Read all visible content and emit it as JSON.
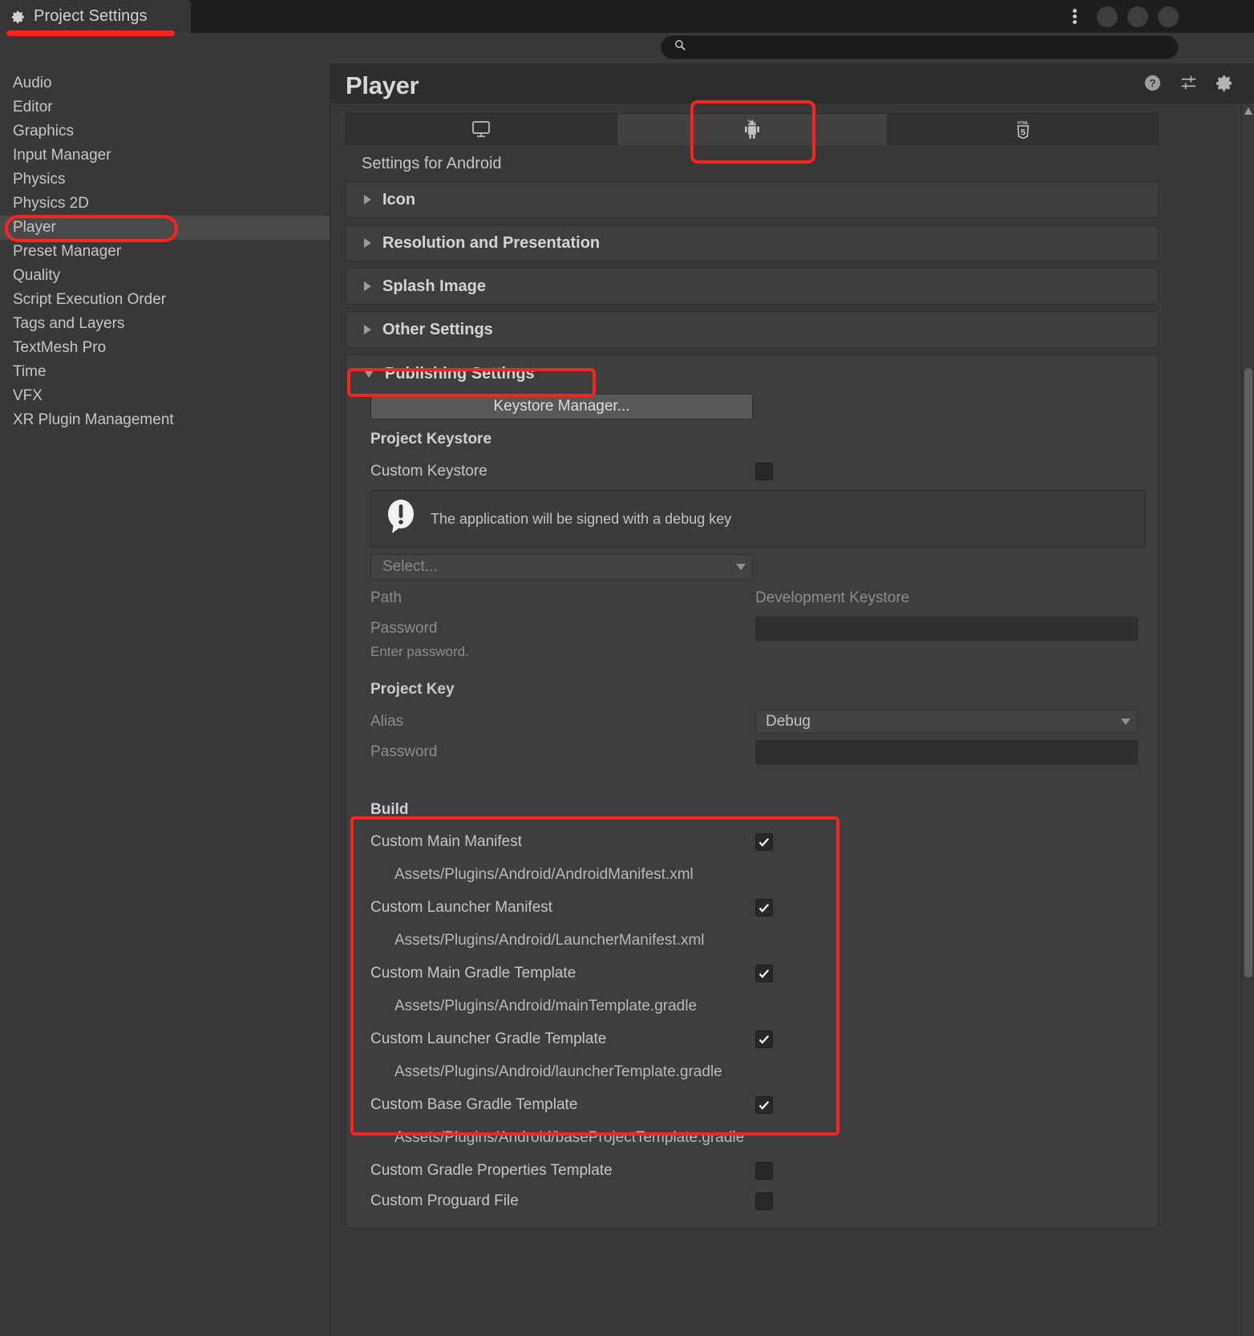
{
  "window": {
    "tab_title": "Project Settings",
    "tab_icon": "gear-icon",
    "menu_icon": "kebab-menu-icon",
    "controls": [
      "minimize-button",
      "maximize-button",
      "close-button"
    ]
  },
  "search": {
    "value": "",
    "placeholder": "",
    "icon": "search-icon"
  },
  "sidebar": {
    "items": [
      {
        "label": "Audio",
        "selected": false
      },
      {
        "label": "Editor",
        "selected": false
      },
      {
        "label": "Graphics",
        "selected": false
      },
      {
        "label": "Input Manager",
        "selected": false
      },
      {
        "label": "Physics",
        "selected": false
      },
      {
        "label": "Physics 2D",
        "selected": false
      },
      {
        "label": "Player",
        "selected": true
      },
      {
        "label": "Preset Manager",
        "selected": false
      },
      {
        "label": "Quality",
        "selected": false
      },
      {
        "label": "Script Execution Order",
        "selected": false
      },
      {
        "label": "Tags and Layers",
        "selected": false
      },
      {
        "label": "TextMesh Pro",
        "selected": false
      },
      {
        "label": "Time",
        "selected": false
      },
      {
        "label": "VFX",
        "selected": false
      },
      {
        "label": "XR Plugin Management",
        "selected": false
      }
    ]
  },
  "main": {
    "title": "Player",
    "header_icons": [
      "help-icon",
      "preset-sliders-icon",
      "gear-icon"
    ],
    "platform_tabs": [
      {
        "icon": "desktop-monitor-icon",
        "name": "standalone",
        "active": false
      },
      {
        "icon": "android-robot-icon",
        "name": "android",
        "active": true
      },
      {
        "icon": "html5-icon",
        "name": "webgl",
        "active": false
      }
    ],
    "settings_for": "Settings for Android",
    "foldouts": [
      {
        "label": "Icon",
        "expanded": false
      },
      {
        "label": "Resolution and Presentation",
        "expanded": false
      },
      {
        "label": "Splash Image",
        "expanded": false
      },
      {
        "label": "Other Settings",
        "expanded": false
      }
    ],
    "publishing": {
      "label": "Publishing Settings",
      "expanded": true,
      "keystore_manager_button": "Keystore Manager...",
      "project_keystore": {
        "title": "Project Keystore",
        "custom_keystore_label": "Custom Keystore",
        "custom_keystore_checked": false,
        "info_icon": "warning-bubble-icon",
        "info_text": "The application will be signed with a debug key",
        "select_placeholder": "Select...",
        "path_label": "Path",
        "path_value": "Development Keystore",
        "password_label": "Password",
        "password_value": "",
        "password_hint": "Enter password."
      },
      "project_key": {
        "title": "Project Key",
        "alias_label": "Alias",
        "alias_value": "Debug",
        "password_label": "Password",
        "password_value": ""
      },
      "build": {
        "title": "Build",
        "rows": [
          {
            "label": "Custom Main Manifest",
            "checked": true,
            "path": "Assets/Plugins/Android/AndroidManifest.xml"
          },
          {
            "label": "Custom Launcher Manifest",
            "checked": true,
            "path": "Assets/Plugins/Android/LauncherManifest.xml"
          },
          {
            "label": "Custom Main Gradle Template",
            "checked": true,
            "path": "Assets/Plugins/Android/mainTemplate.gradle"
          },
          {
            "label": "Custom Launcher Gradle Template",
            "checked": true,
            "path": "Assets/Plugins/Android/launcherTemplate.gradle"
          },
          {
            "label": "Custom Base Gradle Template",
            "checked": true,
            "path": "Assets/Plugins/Android/baseProjectTemplate.gradle"
          },
          {
            "label": "Custom Gradle Properties Template",
            "checked": false,
            "path": ""
          },
          {
            "label": "Custom Proguard File",
            "checked": false,
            "path": ""
          }
        ]
      }
    }
  },
  "annotations": {
    "color": "#fb2222",
    "items": [
      "project-settings-tab-underline",
      "sidebar-player-highlight",
      "android-tab-highlight",
      "publishing-settings-highlight",
      "build-custom-templates-highlight"
    ]
  },
  "scrollbar": {
    "orientation": "vertical",
    "up_arrow_icon": "chevron-up-icon"
  }
}
